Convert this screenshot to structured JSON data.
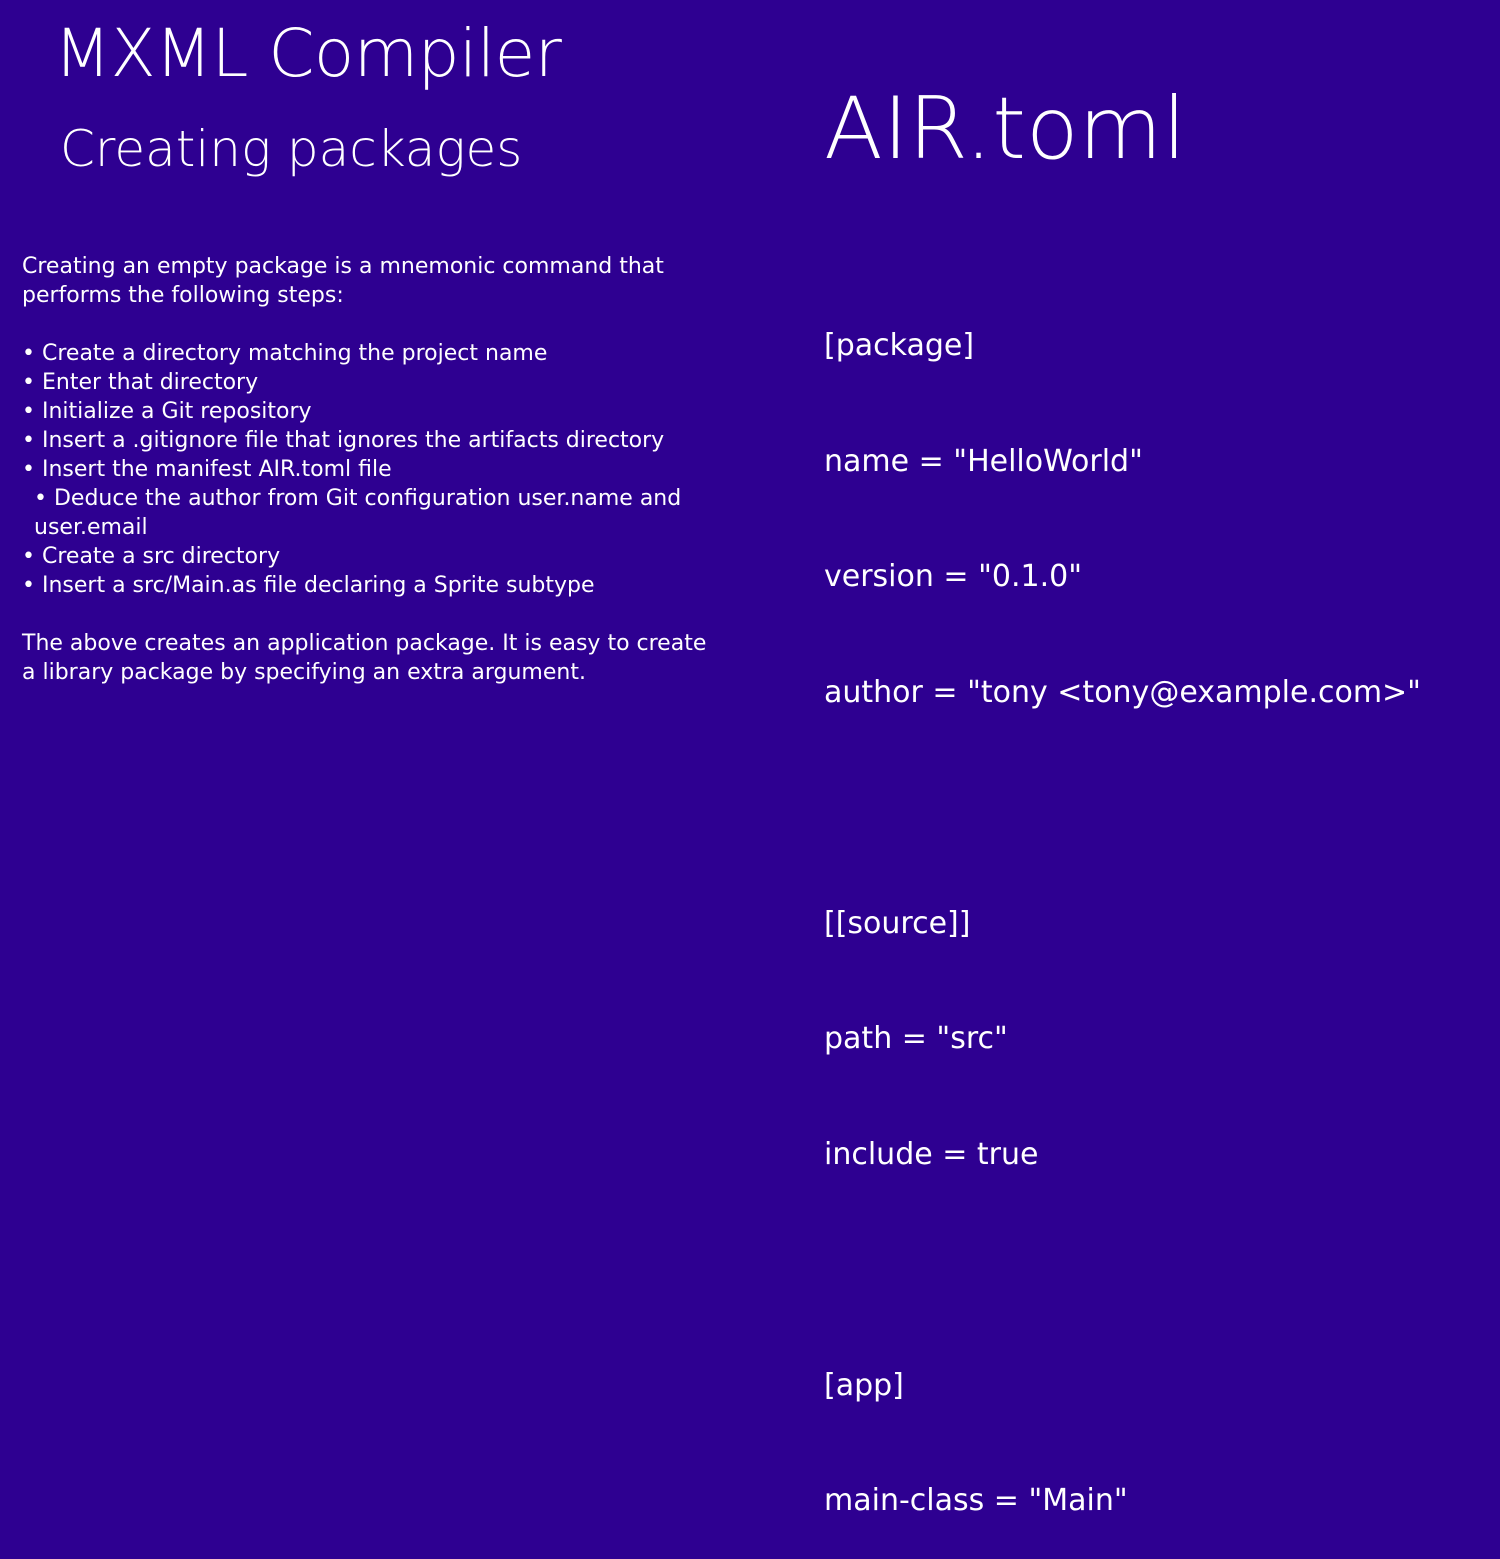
{
  "header": {
    "title": "MXML Compiler",
    "subtitle": "Creating packages"
  },
  "right_panel": {
    "title": "AIR.toml"
  },
  "description": {
    "intro": "Creating an empty package is a mnemonic command that performs the following steps:",
    "steps": [
      "Create a directory matching the project name",
      "Enter that directory",
      "Initialize a Git repository",
      "Insert a .gitignore file that ignores the artifacts directory",
      "Insert the manifest AIR.toml file",
      "Deduce the author from Git configuration user.name and user.email",
      "Create a src directory",
      "Insert a src/Main.as file declaring a Sprite subtype"
    ],
    "bullet": "•",
    "outro": "The above creates an application package. It is easy to create a library package by specifying an extra argument."
  },
  "manifest": {
    "lines": [
      "[package]",
      "name = \"HelloWorld\"",
      "version = \"0.1.0\"",
      "author = \"tony <tony@example.com>\"",
      "",
      "[[source]]",
      "path = \"src\"",
      "include = true",
      "",
      "[app]",
      "main-class = \"Main\""
    ]
  }
}
